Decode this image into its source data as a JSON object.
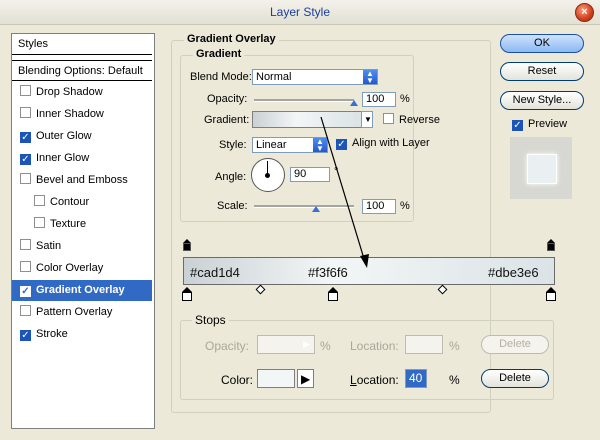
{
  "window": {
    "title": "Layer Style",
    "close_glyph": "×"
  },
  "styles_list": {
    "header": "Styles",
    "blending": "Blending Options: Default",
    "items": [
      {
        "label": "Drop Shadow",
        "checked": false
      },
      {
        "label": "Inner Shadow",
        "checked": false
      },
      {
        "label": "Outer Glow",
        "checked": true
      },
      {
        "label": "Inner Glow",
        "checked": true
      },
      {
        "label": "Bevel and Emboss",
        "checked": false
      },
      {
        "label": "Contour",
        "checked": false
      },
      {
        "label": "Texture",
        "checked": false
      },
      {
        "label": "Satin",
        "checked": false
      },
      {
        "label": "Color Overlay",
        "checked": false
      },
      {
        "label": "Gradient Overlay",
        "checked": true,
        "selected": true
      },
      {
        "label": "Pattern Overlay",
        "checked": false
      },
      {
        "label": "Stroke",
        "checked": true
      }
    ]
  },
  "gradient_overlay": {
    "section_title": "Gradient Overlay",
    "group_title": "Gradient",
    "blend_mode_label": "Blend Mode:",
    "blend_mode_value": "Normal",
    "opacity_label": "Opacity:",
    "opacity_value": "100",
    "opacity_unit": "%",
    "opacity_level": 1.0,
    "gradient_label": "Gradient:",
    "reverse_label": "Reverse",
    "reverse_checked": false,
    "style_label": "Style:",
    "style_value": "Linear",
    "align_label": "Align with Layer",
    "align_checked": true,
    "angle_label": "Angle:",
    "angle_value": "90",
    "angle_unit": "°",
    "scale_label": "Scale:",
    "scale_value": "100",
    "scale_unit": "%",
    "scale_level": 0.5
  },
  "buttons": {
    "ok": "OK",
    "reset": "Reset",
    "new_style": "New Style...",
    "preview_label": "Preview",
    "preview_checked": true
  },
  "gradient_editor": {
    "labels": [
      "#cad1d4",
      "#f3f6f6",
      "#dbe3e6"
    ],
    "colors": [
      "#cad1d4",
      "#f3f6f6",
      "#dbe3e6"
    ],
    "color_stop_locations": [
      0,
      40,
      100
    ],
    "opacity_stop_locations": [
      0,
      100
    ],
    "midpoints": [
      20,
      70
    ]
  },
  "stops": {
    "group_title": "Stops",
    "opacity_label": "Opacity:",
    "opacity_unit": "%",
    "location_label": "Location:",
    "location_unit": "%",
    "delete_label": "Delete",
    "color_label": "Color:",
    "color_location_value": "40",
    "color_swatch": "#f3f6f6"
  }
}
